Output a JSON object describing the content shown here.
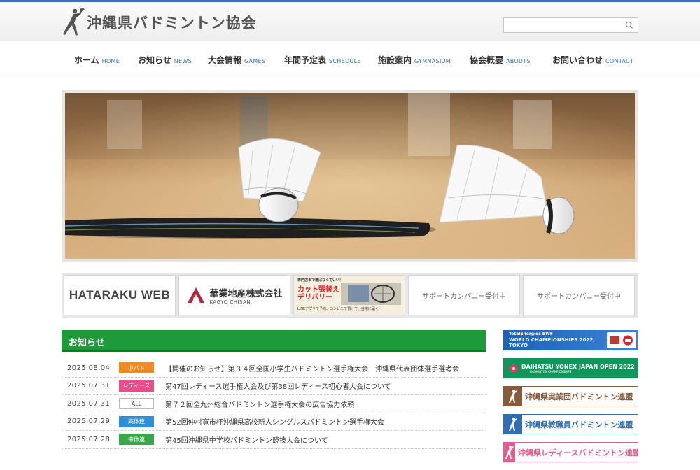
{
  "header": {
    "site_title": "沖縄県バドミントン協会",
    "search": {
      "value": "",
      "placeholder": ""
    }
  },
  "nav": [
    {
      "label": "ホーム",
      "en": "HOME"
    },
    {
      "label": "お知らせ",
      "en": "NEWS"
    },
    {
      "label": "大会情報",
      "en": "GAMES"
    },
    {
      "label": "年間予定表",
      "en": "SCHEDULE"
    },
    {
      "label": "施設案内",
      "en": "GYMNASIUM"
    },
    {
      "label": "協会概要",
      "en": "ABOUTS"
    },
    {
      "label": "お問い合わせ",
      "en": "CONTACT"
    }
  ],
  "sponsors": {
    "hataraku": "HATARAKU WEB",
    "kagyo_name": "華業地産株式会社",
    "kagyo_en": "KAGYO CHISAN",
    "cut_top": "専門店まで運ばなくていい！",
    "cut_main": "カット張替えデリバリー",
    "cut_bottom": "LINEアプリで予約、コンビニで預けて、自宅に届く",
    "support_1": "サポートカンパニー受付中",
    "support_2": "サポートカンパニー受付中"
  },
  "news": {
    "heading": "お知らせ",
    "items": [
      {
        "date": "2025.08.04",
        "category": "小バド",
        "cat_color": "#f08a24",
        "title": "【開催のお知らせ】第３４回全国小学生バドミントン選手権大会　沖縄県代表団体選手選考会"
      },
      {
        "date": "2025.07.31",
        "category": "レディース",
        "cat_color": "#e94d8a",
        "title": "第47回レディース選手権大会及び第38回レディース初心者大会について"
      },
      {
        "date": "2025.07.31",
        "category": "ALL",
        "cat_color": "#ffffff",
        "title": "第７２回全九州総合バドミントン選手権大会の広告協力依頼"
      },
      {
        "date": "2025.07.29",
        "category": "高体連",
        "cat_color": "#2e8fd8",
        "title": "第52回仲村寛市杯沖縄県高校新人シングルスバドミントン選手権大会"
      },
      {
        "date": "2025.07.28",
        "category": "中体連",
        "cat_color": "#3aa84a",
        "title": "第45回沖縄県中学校バドミントン競技大会について"
      }
    ]
  },
  "side_banners": {
    "bwf_line1": "TotalEnergies BWF",
    "bwf_line2": "WORLD CHAMPIONSHIPS 2022,",
    "bwf_line3": "TOKYO",
    "daihatsu": "DAIHATSU YONEX JAPAN OPEN 2022",
    "daihatsu_sub": "BADMINTON CHAMPIONSHIPS",
    "jitsugyodan": "沖縄県実業団バドミントン連盟",
    "kyoshokuin": "沖縄県教職員バドミントン連盟",
    "ladies": "沖縄県レディースバドミントン連盟"
  },
  "colors": {
    "accent_blue": "#3b6fb6",
    "news_green": "#1e9a3a",
    "jitsugyodan": "#8a5a3c",
    "kyoshokuin": "#2f6db5",
    "ladies": "#e85b8e"
  }
}
